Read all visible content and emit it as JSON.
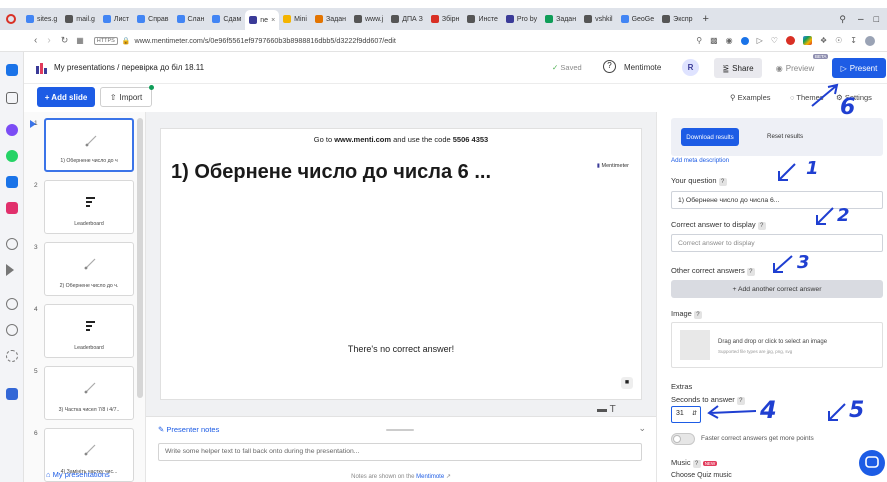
{
  "browser": {
    "tabs": [
      {
        "label": "sites.g",
        "color": "#4285f4"
      },
      {
        "label": "mail.g",
        "color": "#555"
      },
      {
        "label": "Лист",
        "color": "#4285f4"
      },
      {
        "label": "Справ",
        "color": "#4285f4"
      },
      {
        "label": "Слан",
        "color": "#4285f4"
      },
      {
        "label": "Сдам",
        "color": "#4285f4"
      },
      {
        "label": "ne",
        "color": "#3b3b98",
        "active": true
      },
      {
        "label": "Mini",
        "color": "#f4b400"
      },
      {
        "label": "Задан",
        "color": "#e37400"
      },
      {
        "label": "www.j",
        "color": "#555"
      },
      {
        "label": "ДПА З",
        "color": "#555"
      },
      {
        "label": "Збірн",
        "color": "#d93025"
      },
      {
        "label": "Инсте",
        "color": "#555"
      },
      {
        "label": "Pro by",
        "color": "#3b3b98"
      },
      {
        "label": "Задан",
        "color": "#0f9d58"
      },
      {
        "label": "vshkil",
        "color": "#555"
      },
      {
        "label": "GeoGe",
        "color": "#4285f4"
      },
      {
        "label": "Экспр",
        "color": "#555"
      }
    ],
    "url": "www.mentimeter.com/s/0e96f5561ef9797660b3b8988816dbb5/d3222f9dd607/edit",
    "https_badge": "HTTPS"
  },
  "header": {
    "breadcrumb": "My presentations / перевірка до біл 18.11",
    "saved": "Saved",
    "mentimote": "Mentimote",
    "avatar": "R",
    "share": "Share",
    "preview": "Preview",
    "beta": "BETA",
    "present": "Present"
  },
  "toolbar": {
    "add_slide": "+ Add slide",
    "import": "Import",
    "examples": "Examples",
    "themes": "Themes",
    "settings": "Settings"
  },
  "slides": [
    {
      "num": "1",
      "label": "1) Обернене число до ч",
      "type": "quiz",
      "selected": true
    },
    {
      "num": "2",
      "label": "Leaderboard",
      "type": "leaderboard"
    },
    {
      "num": "3",
      "label": "2) Обернене число до ч.",
      "type": "quiz"
    },
    {
      "num": "4",
      "label": "Leaderboard",
      "type": "leaderboard"
    },
    {
      "num": "5",
      "label": "3) Частка чисел 7/8 і 4/7..",
      "type": "quiz"
    },
    {
      "num": "6",
      "label": "4) Замініть частку чис...",
      "type": "quiz"
    }
  ],
  "slide_list_footer": "My presentations",
  "canvas": {
    "instruction_prefix": "Go to ",
    "instruction_site": "www.menti.com",
    "instruction_mid": " and use the code ",
    "instruction_code": "5506 4353",
    "logo": "Mentimeter",
    "title": "1) Обернене число до числа 6 ...",
    "no_answer": "There's no correct answer!"
  },
  "notes": {
    "label": "Presenter notes",
    "placeholder": "Write some helper text to fall back onto during the presentation...",
    "footer": "Notes are shown on the",
    "footer_link": "Mentimote"
  },
  "panel": {
    "tab_download": "Download results",
    "tab_reset": "Reset results",
    "meta": "Add meta description",
    "your_question_label": "Your question",
    "your_question_value": "1)   Обернене число до числа 6...",
    "correct_display_label": "Correct answer to display",
    "correct_display_placeholder": "Correct answer to display",
    "other_answers_label": "Other correct answers",
    "add_another": "+ Add another correct answer",
    "image_label": "Image",
    "dropzone": "Drag and drop or click to select an image",
    "dropzone_sub": "Supported file types are jpg, png, svg",
    "extras": "Extras",
    "seconds_label": "Seconds to answer",
    "seconds_value": "31",
    "faster": "Faster correct answers get more points",
    "music": "Music",
    "music_badge": "NEW",
    "choose_music": "Choose Quiz music"
  },
  "annotations": {
    "n1": "1",
    "n2": "2",
    "n3": "3",
    "n4": "4",
    "n5": "5",
    "n6": "6"
  },
  "colors": {
    "accent": "#1d5ce5",
    "brand": "#3b3b98",
    "hand_ink": "#1f3fd1",
    "panel_tab_bg": "#1d5ce5"
  }
}
